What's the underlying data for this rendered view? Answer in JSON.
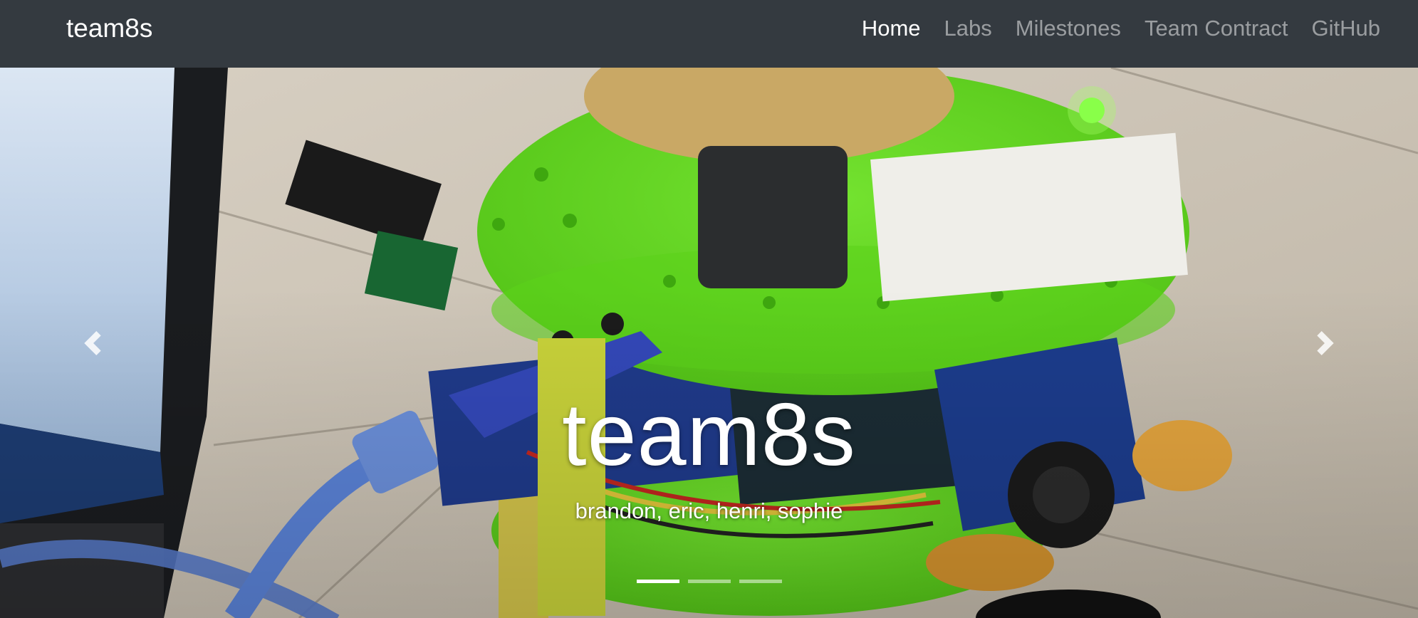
{
  "navbar": {
    "brand": "team8s",
    "links": [
      {
        "label": "Home",
        "active": true
      },
      {
        "label": "Labs",
        "active": false
      },
      {
        "label": "Milestones",
        "active": false
      },
      {
        "label": "Team Contract",
        "active": false
      },
      {
        "label": "GitHub",
        "active": false
      }
    ]
  },
  "carousel": {
    "title": "team8s",
    "subtitle": "brandon, eric, henri, sophie",
    "slide_count": 3,
    "active_slide": 1,
    "prev_icon": "chevron-left-icon",
    "next_icon": "chevron-right-icon"
  },
  "colors": {
    "navbar_bg": "#343a40",
    "nav_link_active": "#ffffff",
    "robot_plate": "#66dd22",
    "floor": "#cfc6b8"
  }
}
